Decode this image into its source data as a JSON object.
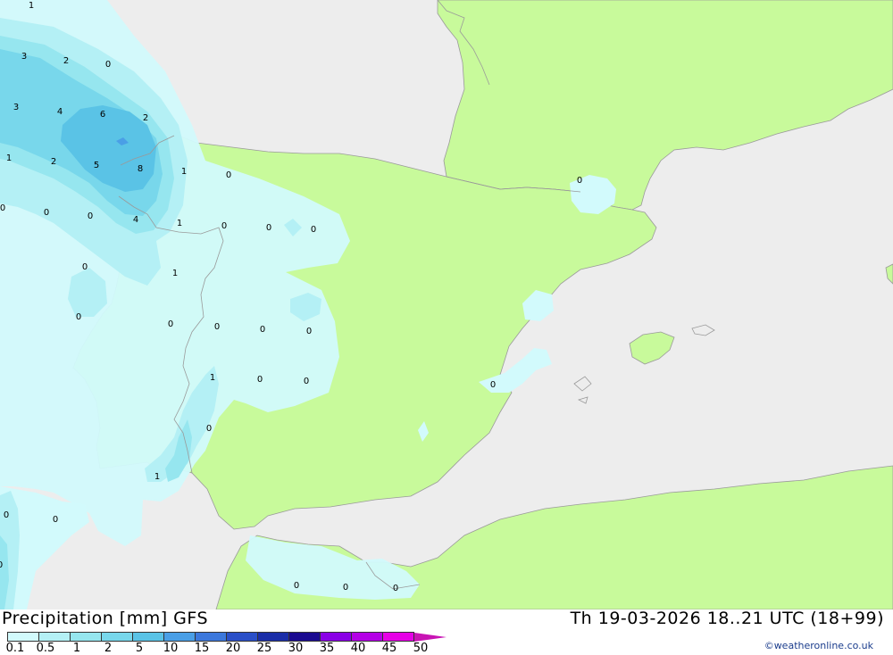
{
  "title_left": "Precipitation [mm] GFS",
  "title_right": "Th 19-03-2026 18..21 UTC (18+99)",
  "credit": "©weatheronline.co.uk",
  "colors": {
    "sea": "#ededed",
    "land": "#c8fa9b",
    "border": "#9a9a9a"
  },
  "legend": {
    "values": [
      "0.1",
      "0.5",
      "1",
      "2",
      "5",
      "10",
      "15",
      "20",
      "25",
      "30",
      "35",
      "40",
      "45",
      "50"
    ],
    "colors": [
      "#d2fafc",
      "#b4f0f5",
      "#96e6ef",
      "#78d7eb",
      "#5ac3e6",
      "#4a9fe6",
      "#3c78dc",
      "#2a4fc8",
      "#1a2da8",
      "#1a0a90",
      "#8a00e6",
      "#b400e6",
      "#e600e6",
      "#c814b4"
    ]
  },
  "map_labels": [
    "1",
    "3",
    "2",
    "0",
    "3",
    "4",
    "6",
    "2",
    "1",
    "2",
    "5",
    "8",
    "1",
    "0",
    "0",
    "0",
    "0",
    "4",
    "1",
    "0",
    "0",
    "0",
    "0",
    "0",
    "1",
    "0",
    "0",
    "0",
    "0",
    "0",
    "1",
    "0",
    "0",
    "0",
    "0",
    "1",
    "0",
    "0",
    "0",
    "0",
    "0",
    "0"
  ]
}
